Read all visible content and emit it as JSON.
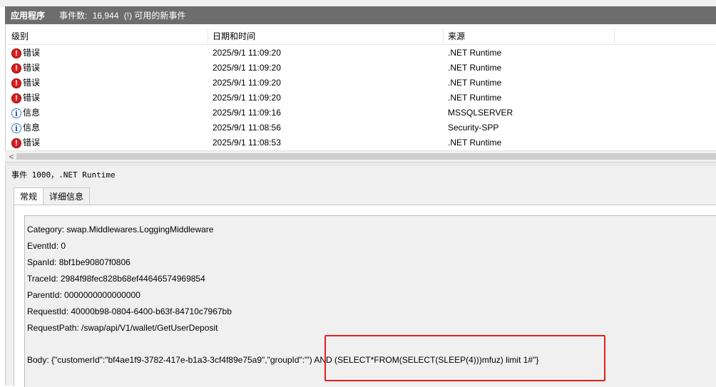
{
  "titlebar": {
    "title": "应用程序",
    "count_label": "事件数:",
    "count_value": "16,944",
    "new_events": "(!) 可用的新事件"
  },
  "columns": {
    "level": "级别",
    "datetime": "日期和时间",
    "source": "来源"
  },
  "events": [
    {
      "level": "错误",
      "icon": "error-icon",
      "datetime": "2025/9/1 11:09:20",
      "source": ".NET Runtime"
    },
    {
      "level": "错误",
      "icon": "error-icon",
      "datetime": "2025/9/1 11:09:20",
      "source": ".NET Runtime"
    },
    {
      "level": "错误",
      "icon": "error-icon",
      "datetime": "2025/9/1 11:09:20",
      "source": ".NET Runtime"
    },
    {
      "level": "错误",
      "icon": "error-icon",
      "datetime": "2025/9/1 11:09:20",
      "source": ".NET Runtime"
    },
    {
      "level": "信息",
      "icon": "info-icon",
      "datetime": "2025/9/1 11:09:16",
      "source": "MSSQLSERVER"
    },
    {
      "level": "信息",
      "icon": "info-icon",
      "datetime": "2025/9/1 11:08:56",
      "source": "Security-SPP"
    },
    {
      "level": "错误",
      "icon": "error-icon",
      "datetime": "2025/9/1 11:08:53",
      "source": ".NET Runtime"
    }
  ],
  "scroll": {
    "left_arrow": "<"
  },
  "detail": {
    "event_title": "事件 1000，.NET Runtime",
    "tabs": [
      "常规",
      "详细信息"
    ],
    "lines": [
      "Category: swap.Middlewares.LoggingMiddleware",
      "EventId: 0",
      "SpanId: 8bf1be90807f0806",
      "TraceId: 2984f98fec828b68ef44646574969854",
      "ParentId: 0000000000000000",
      "RequestId: 40000b98-0804-6400-b63f-84710c7967bb",
      "RequestPath: /swap/api/V1/wallet/GetUserDeposit",
      "Body: {\"customerId\":\"bf4ae1f9-3782-417e-b1a3-3cf4f89e75a9\",\"groupId\":\"') AND (SELECT*FROM(SELECT(SLEEP(4)))mfuz) limit 1#\"}"
    ]
  },
  "colors": {
    "titlebar_bg": "#6d6d6d",
    "error_red": "#d61f1f",
    "info_blue": "#3b74c4",
    "highlight_box": "#e11f1f"
  }
}
